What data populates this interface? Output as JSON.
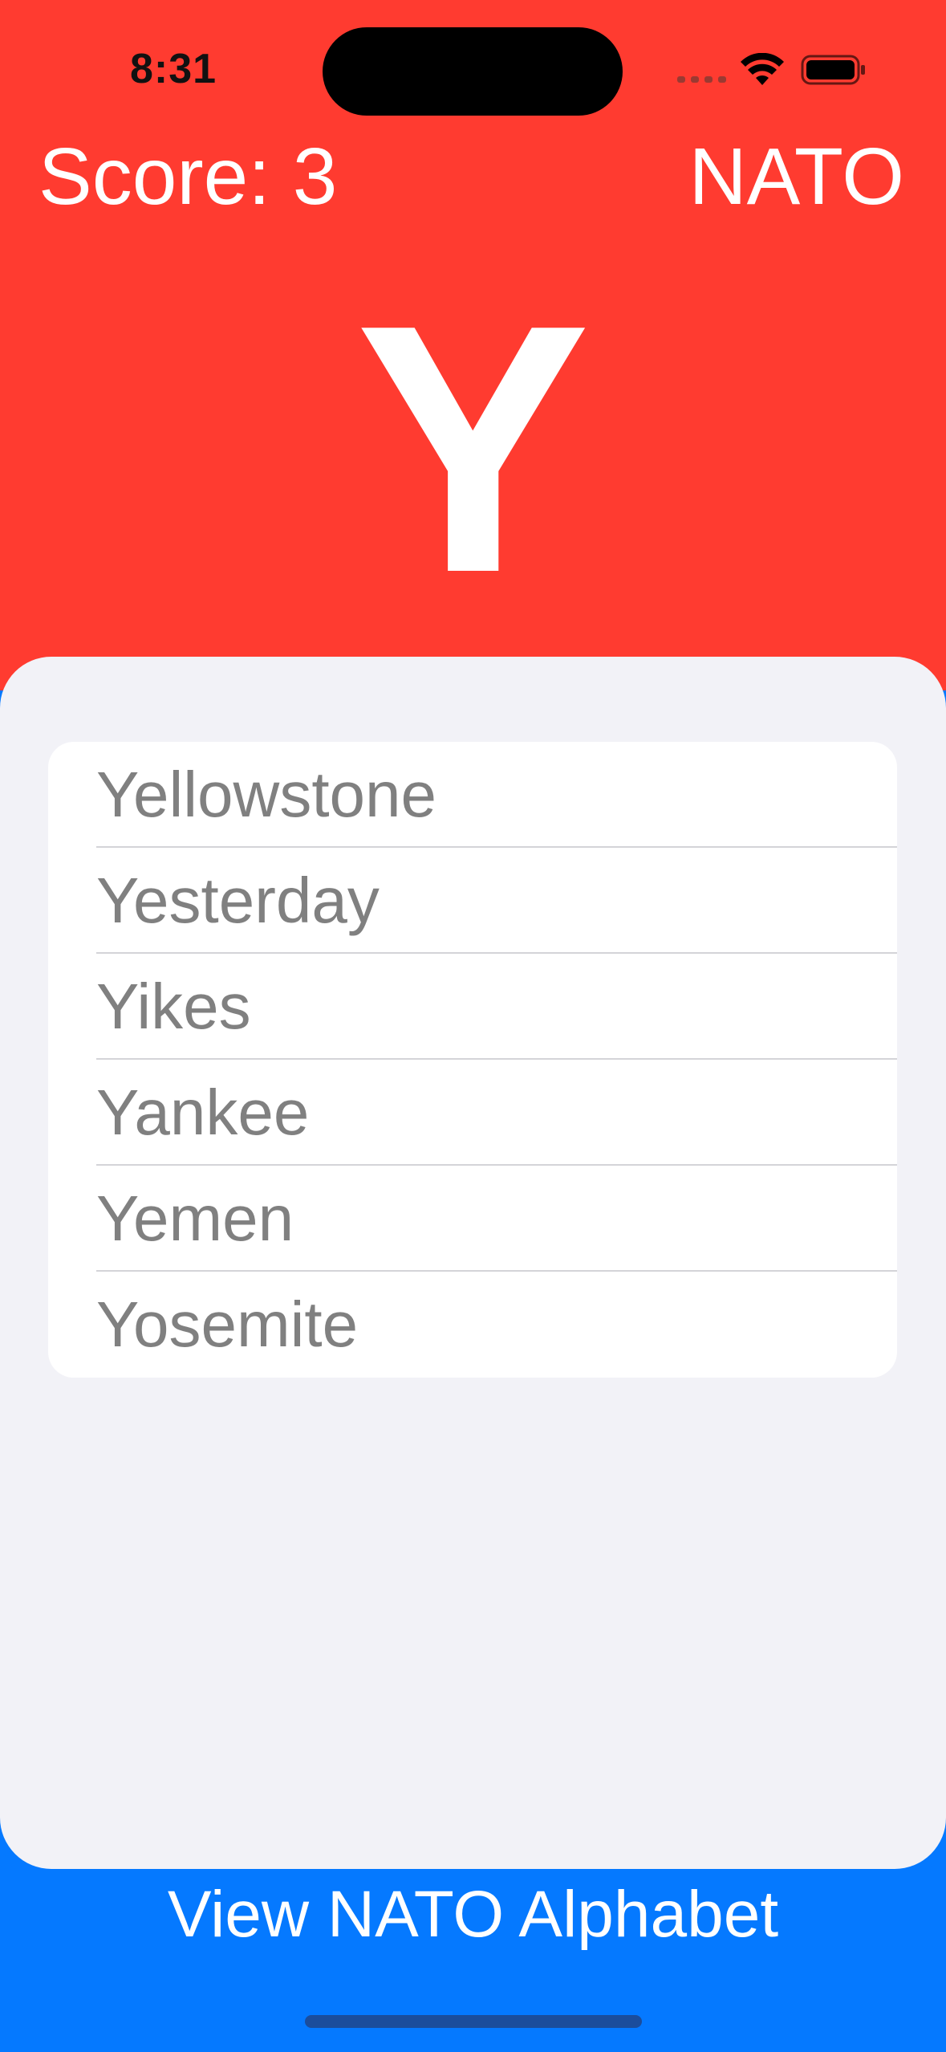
{
  "status_bar": {
    "time": "8:31"
  },
  "header": {
    "score_label": "Score: 3",
    "mode_label": "NATO"
  },
  "card": {
    "letter": "Y"
  },
  "options": [
    {
      "label": "Yellowstone"
    },
    {
      "label": "Yesterday"
    },
    {
      "label": "Yikes"
    },
    {
      "label": "Yankee"
    },
    {
      "label": "Yemen"
    },
    {
      "label": "Yosemite"
    }
  ],
  "footer": {
    "button_label": "View NATO Alphabet"
  },
  "colors": {
    "top_background": "#ff3b30",
    "sheet_background": "#f2f2f7",
    "button_background": "#0579ff"
  }
}
